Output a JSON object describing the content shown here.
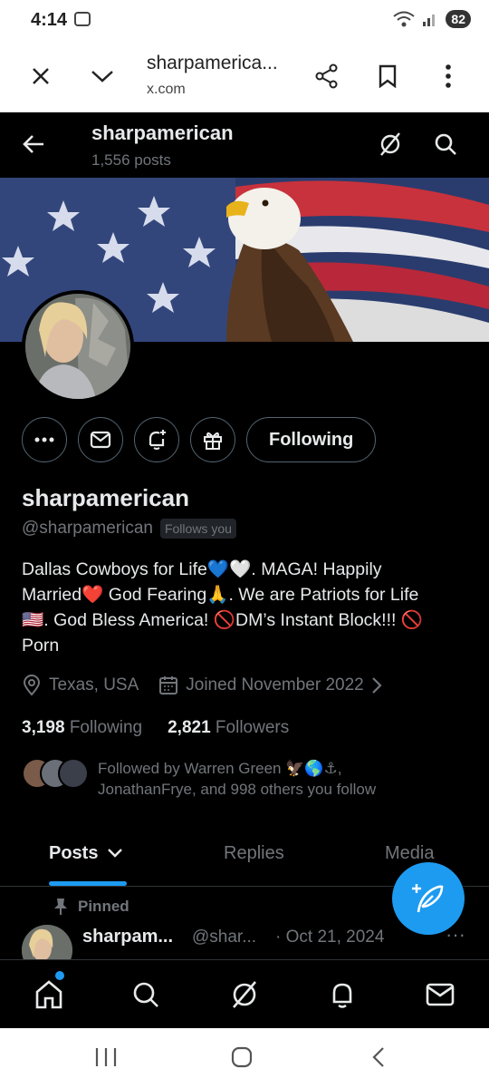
{
  "status_bar": {
    "time": "4:14",
    "battery": "82"
  },
  "browser": {
    "title": "sharpamerica...",
    "url": "x.com"
  },
  "header": {
    "name": "sharpamerican",
    "post_count": "1,556 posts"
  },
  "profile": {
    "display_name": "sharpamerican",
    "handle": "@sharpamerican",
    "follows_you": "Follows you",
    "following_button": "Following",
    "bio_line1": "Dallas Cowboys for Life💙🤍. MAGA! Happily",
    "bio_line2": "Married❤️ God Fearing🙏. We are Patriots for Life",
    "bio_line3": "🇺🇸. God Bless America! 🚫DM’s Instant Block!!! 🚫",
    "bio_line4": "Porn",
    "location": "Texas, USA",
    "joined": "Joined November 2022",
    "following_count": "3,198",
    "following_label": "Following",
    "followers_count": "2,821",
    "followers_label": "Followers",
    "followed_by_line1": "Followed by Warren Green 🦅🌎⚓,",
    "followed_by_line2": "JonathanFrye, and 998 others you follow"
  },
  "tabs": [
    {
      "label": "Posts"
    },
    {
      "label": "Replies"
    },
    {
      "label": "Media"
    }
  ],
  "pinned_post": {
    "pinned_label": "Pinned",
    "name": "sharpam...",
    "handle": "@shar...",
    "date": "· Oct 21, 2024"
  },
  "colors": {
    "accent": "#1d9bf0",
    "background": "#000000",
    "text": "#e7e9ea",
    "muted": "#71767b"
  }
}
